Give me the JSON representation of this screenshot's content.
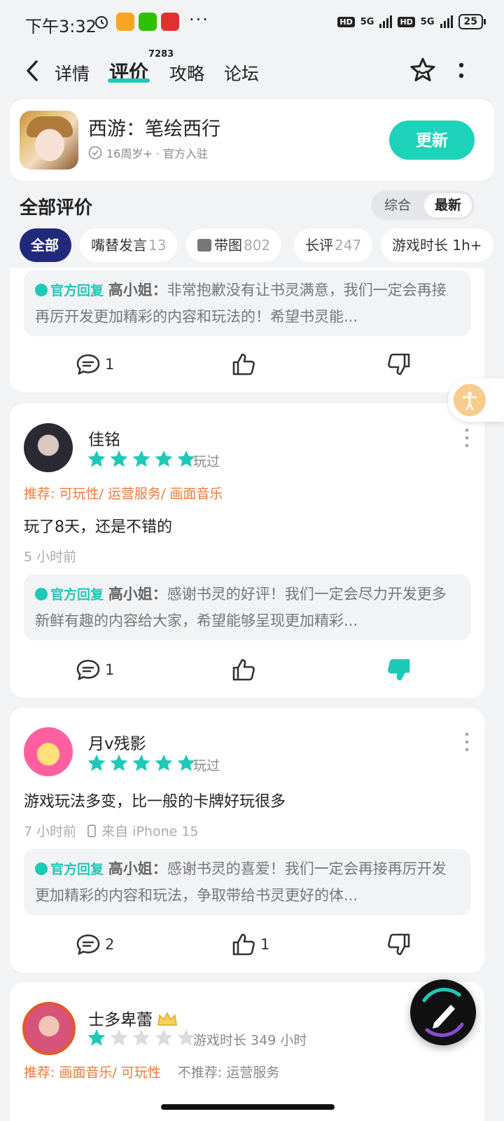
{
  "status_bar": {
    "time": "下午3:32",
    "dots": "···",
    "net1": "5G",
    "net2": "5G",
    "hd": "HD",
    "battery": "25"
  },
  "nav": {
    "tabs": [
      {
        "label": "详情"
      },
      {
        "label": "评价",
        "active": true
      },
      {
        "label": "攻略"
      },
      {
        "label": "论坛"
      }
    ],
    "review_count_badge": "7283"
  },
  "game": {
    "title": "西游：笔绘西行",
    "subtitle": "16周岁+ · 官方入驻",
    "update_label": "更新"
  },
  "reviews_header": {
    "title": "全部评价",
    "sort_options": [
      "综合",
      "最新"
    ],
    "sort_selected": "最新"
  },
  "filters": [
    {
      "label": "全部",
      "count": ""
    },
    {
      "label": "嘴替发言",
      "count": "13"
    },
    {
      "label": "带图",
      "count": "802"
    },
    {
      "label": "长评",
      "count": "247"
    },
    {
      "label": "游戏时长 1h+",
      "count": ""
    }
  ],
  "colors": {
    "accent": "#1dc9b7",
    "chip_active": "#23297a",
    "tag_orange": "#f07838"
  },
  "reviews": [
    {
      "reply": {
        "label": "官方回复",
        "author": "高小姐",
        "text": "非常抱歉没有让书灵满意，我们一定会再接再厉开发更加精彩的内容和玩法的！希望书灵能..."
      },
      "comments": "1",
      "likes": "",
      "dislikes": ""
    },
    {
      "user": "佳铭",
      "rating": 5,
      "played": "玩过",
      "tags": "推荐: 可玩性/ 运营服务/ 画面音乐",
      "content": "玩了8天，还是不错的",
      "time": "5 小时前",
      "reply": {
        "label": "官方回复",
        "author": "高小姐",
        "text": "感谢书灵的好评！我们一定会尽力开发更多新鲜有趣的内容给大家，希望能够呈现更加精彩..."
      },
      "comments": "1",
      "likes": "",
      "dislikes": ""
    },
    {
      "user": "月v残影",
      "rating": 5,
      "played": "玩过",
      "content": "游戏玩法多变，比一般的卡牌好玩很多",
      "time": "7 小时前",
      "device": "来自 iPhone 15",
      "reply": {
        "label": "官方回复",
        "author": "高小姐",
        "text": "感谢书灵的喜爱！我们一定会再接再厉开发更加精彩的内容和玩法，争取带给书灵更好的体..."
      },
      "comments": "2",
      "likes": "1",
      "dislikes": ""
    },
    {
      "user": "士多卑蕾",
      "rating": 1,
      "played": "游戏时长 349 小时",
      "tags_pos": "推荐: 画面音乐/ 可玩性",
      "tags_neg": "不推荐: 运营服务"
    }
  ]
}
